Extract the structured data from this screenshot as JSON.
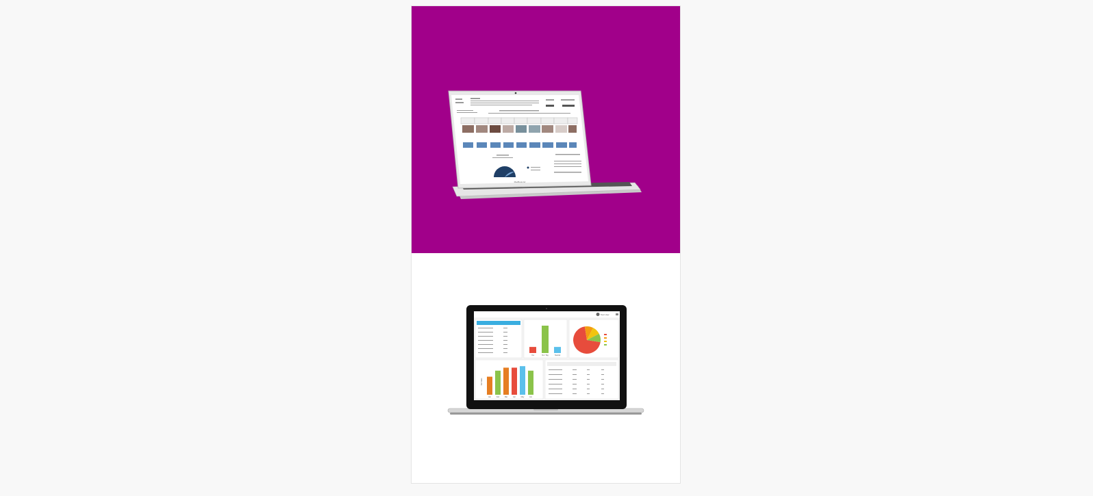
{
  "top_image": {
    "label": "MacBook Air"
  },
  "bottom_image": {
    "user_label": "Test User",
    "bar_chart_small": {
      "categories": [
        "Yes",
        "No / Tag",
        "Neutral"
      ],
      "values": [
        2,
        9,
        2
      ],
      "colors": [
        "#e74c3c",
        "#8bc34a",
        "#5bc0eb"
      ]
    },
    "bar_chart_large": {
      "ylabel": "Net Sales",
      "categories": [
        "Jan",
        "Feb",
        "Mar",
        "Apr",
        "May",
        "Jun"
      ],
      "values": [
        6,
        8,
        9,
        9,
        9.5,
        8
      ],
      "colors": [
        "#e67e22",
        "#8bc34a",
        "#e67e22",
        "#e74c3c",
        "#5bc0eb",
        "#8bc34a"
      ]
    },
    "pie_chart": {
      "values": [
        70,
        10,
        10,
        10
      ],
      "colors": [
        "#e74c3c",
        "#f39c12",
        "#f1c40f",
        "#8bc34a"
      ]
    }
  }
}
